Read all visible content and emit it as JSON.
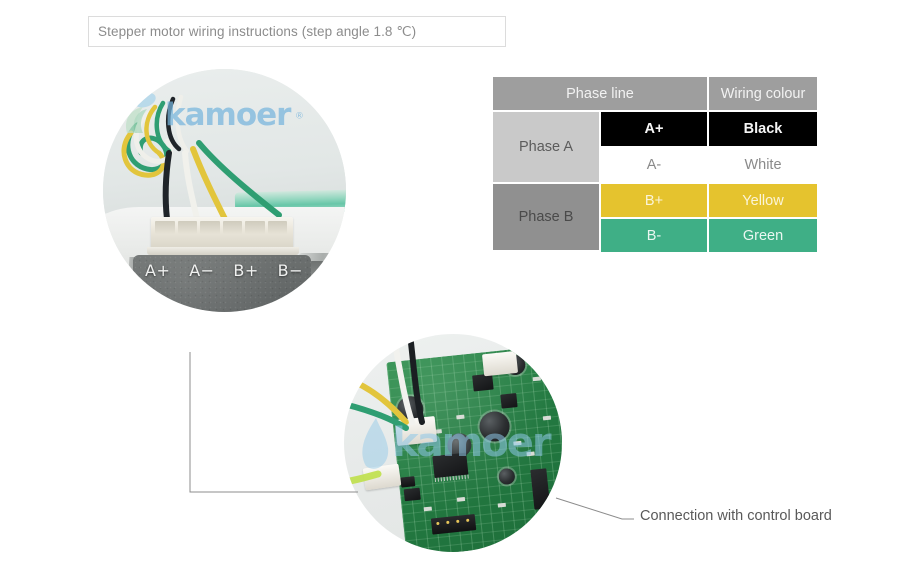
{
  "title": {
    "text": "Stepper motor wiring instructions (step angle 1.8 ℃)"
  },
  "photos": {
    "motor": {
      "name": "stepper-motor-connector-photo",
      "watermark": "kamoer",
      "watermark_registered": "®",
      "pin_labels": [
        "A+",
        "A−",
        "B+",
        "B−"
      ]
    },
    "board": {
      "name": "control-board-photo",
      "watermark": "kamoer"
    }
  },
  "callout": {
    "label": "Connection with control board"
  },
  "table": {
    "headers": {
      "phase_line": "Phase line",
      "wiring_colour": "Wiring colour"
    },
    "groups": [
      {
        "phase": "Phase A",
        "group_bg": "#c9c9c9",
        "rows": [
          {
            "line": "A+",
            "colour": "Black",
            "bg": "#000000",
            "fg": "#f5f5f5"
          },
          {
            "line": "A-",
            "colour": "White",
            "bg": "#ffffff",
            "fg": "#8a8a8a"
          }
        ]
      },
      {
        "phase": "Phase B",
        "group_bg": "#909090",
        "rows": [
          {
            "line": "B+",
            "colour": "Yellow",
            "bg": "#e5c32e",
            "fg": "#fbf4d8"
          },
          {
            "line": "B-",
            "colour": "Green",
            "bg": "#3faf86",
            "fg": "#eaf7f1"
          }
        ]
      }
    ]
  },
  "colors": {
    "background": "#ffffff",
    "header_gray": "#9e9e9e",
    "phase_a_gray": "#c9c9c9",
    "phase_b_gray": "#909090",
    "black": "#000000",
    "white": "#ffffff",
    "yellow": "#e5c32e",
    "green": "#3faf86",
    "title_text": "#8c8c8c",
    "title_border": "#dcdcdc",
    "leader_line": "#8c8c8c",
    "callout_text": "#595959",
    "watermark_blue": "#77b4dd"
  }
}
